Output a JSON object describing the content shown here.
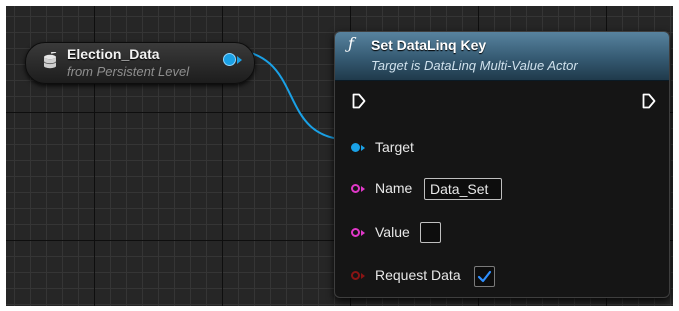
{
  "variable_node": {
    "title": "Election_Data",
    "subtitle": "from Persistent Level",
    "icon": "database-icon",
    "pin_color": "#1aa1e6"
  },
  "function_node": {
    "title": "Set DataLinq Key",
    "subtitle": "Target is DataLinq Multi-Value Actor",
    "icon": "function-icon",
    "header_color": "#4a7590",
    "pins": {
      "target": {
        "label": "Target",
        "color": "#1aa1e6"
      },
      "name": {
        "label": "Name",
        "value": "Data_Set",
        "color": "#e038c8"
      },
      "value": {
        "label": "Value",
        "checked": false,
        "color": "#e038c8"
      },
      "request_data": {
        "label": "Request Data",
        "checked": true,
        "color": "#8a1414"
      }
    }
  },
  "wire": {
    "color": "#1aa1e6"
  }
}
